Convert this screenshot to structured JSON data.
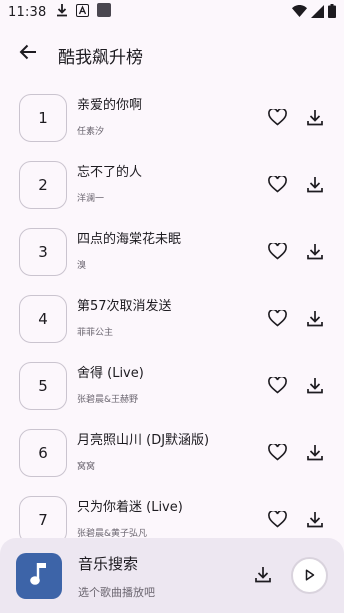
{
  "status_bar": {
    "time": "11:38",
    "left_icons": [
      "download-icon",
      "font-a-icon",
      "app-square-icon"
    ],
    "right_icons": [
      "wifi-icon",
      "signal-icon",
      "battery-icon"
    ]
  },
  "header": {
    "title": "酷我飙升榜"
  },
  "songs": [
    {
      "rank": "1",
      "title": "亲爱的你啊",
      "artist": "任素汐"
    },
    {
      "rank": "2",
      "title": "忘不了的人",
      "artist": "洋澜一"
    },
    {
      "rank": "3",
      "title": "四点的海棠花未眠",
      "artist": "溴"
    },
    {
      "rank": "4",
      "title": "第57次取消发送",
      "artist": "菲菲公主"
    },
    {
      "rank": "5",
      "title": "舍得 (Live)",
      "artist": "张碧晨&王赫野"
    },
    {
      "rank": "6",
      "title": "月亮照山川 (DJ默涵版)",
      "artist": "窝窝"
    },
    {
      "rank": "7",
      "title": "只为你着迷 (Live)",
      "artist": "张碧晨&黄子弘凡"
    }
  ],
  "player": {
    "title": "音乐搜索",
    "subtitle": "选个歌曲播放吧"
  },
  "colors": {
    "background": "#fcf7fc",
    "player_bar": "#ede7f1",
    "cover": "#3d64a8"
  }
}
